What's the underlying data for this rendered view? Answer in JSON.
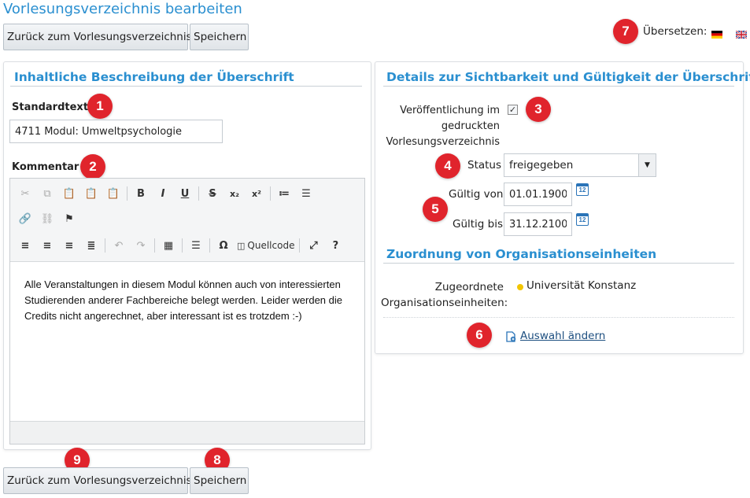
{
  "page": {
    "title": "Vorlesungsverzeichnis bearbeiten"
  },
  "toolbar_top": {
    "back_label": "Zurück zum Vorlesungsverzeichnis",
    "save_label": "Speichern"
  },
  "translate": {
    "label": "Übersetzen:",
    "languages": [
      "de",
      "en"
    ]
  },
  "badges": [
    "1",
    "2",
    "3",
    "4",
    "5",
    "6",
    "7",
    "8",
    "9"
  ],
  "left_panel": {
    "title": "Inhaltliche Beschreibung der Überschrift",
    "standardtext_label": "Standardtext",
    "standardtext_value": "4711 Modul: Umweltpsychologie",
    "kommentar_label": "Kommentar",
    "editor": {
      "source_label": "Quellcode",
      "content": "Alle Veranstaltungen in diesem Modul können auch von interessierten Studierenden anderer Fachbereiche belegt werden. Leider werden die Credits nicht angerechnet, aber interessant ist es trotzdem :-)"
    }
  },
  "right_panel": {
    "title": "Details zur Sichtbarkeit und Gültigkeit der Überschrift",
    "publish_label_1": "Veröffentlichung im",
    "publish_label_2": "gedruckten",
    "publish_label_3": "Vorlesungsverzeichnis",
    "publish_checked": true,
    "status_label": "Status",
    "status_value": "freigegeben",
    "valid_from_label": "Gültig von",
    "valid_from_value": "01.01.1900",
    "valid_to_label": "Gültig bis",
    "valid_to_value": "31.12.2100",
    "calendar_day": "12",
    "org_title": "Zuordnung von Organisationseinheiten",
    "org_label_1": "Zugeordnete",
    "org_label_2": "Organisationseinheiten:",
    "org_value": "Universität Konstanz",
    "org_dot_color": "#f2c500",
    "change_link": "Auswahl ändern"
  },
  "toolbar_bottom": {
    "back_label": "Zurück zum Vorlesungsverzeichnis",
    "save_label": "Speichern"
  }
}
